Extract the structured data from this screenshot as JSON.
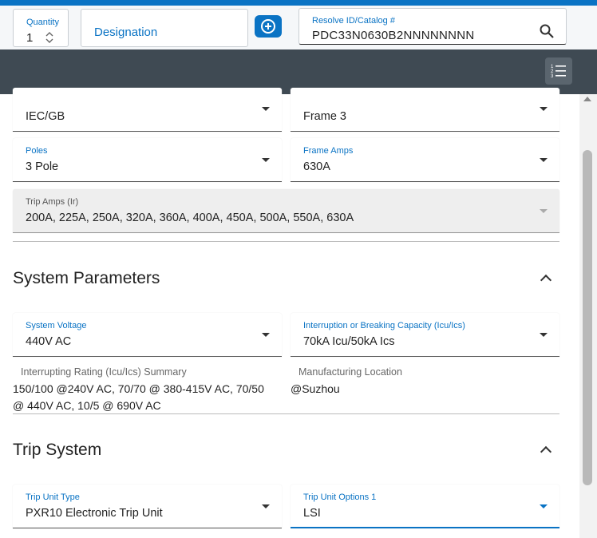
{
  "header": {
    "quantity_label": "Quantity",
    "quantity_value": "1",
    "designation_label": "Designation",
    "resolve_label": "Resolve ID/Catalog #",
    "resolve_value": "PDC33N0630B2NNNNNNNN"
  },
  "fields_top": {
    "standard_value": "IEC/GB",
    "frame_value": "Frame 3",
    "poles_label": "Poles",
    "poles_value": "3 Pole",
    "frame_amps_label": "Frame Amps",
    "frame_amps_value": "630A",
    "trip_amps_label": "Trip Amps (Ir)",
    "trip_amps_value": "200A, 225A, 250A, 320A, 360A, 400A, 450A, 500A, 550A, 630A"
  },
  "system_parameters": {
    "title": "System Parameters",
    "voltage_label": "System Voltage",
    "voltage_value": "440V AC",
    "capacity_label": "Interruption or Breaking Capacity (Icu/Ics)",
    "capacity_value": "70kA Icu/50kA Ics",
    "rating_summary_label": "Interrupting Rating (Icu/Ics) Summary",
    "rating_summary_value_1": "150/100 @240V AC, 70/70 @ 380-415V AC, 70/50",
    "rating_summary_value_2": "@ 440V AC, 10/5 @ 690V AC",
    "location_label": "Manufacturing Location",
    "location_value": "@Suzhou"
  },
  "trip_system": {
    "title": "Trip System",
    "unit_type_label": "Trip Unit Type",
    "unit_type_value": "PXR10 Electronic Trip Unit",
    "options_label": "Trip Unit Options 1",
    "options_value": "LSI"
  },
  "colors": {
    "accent": "#0a73c4",
    "dark_bar": "#3f4a53"
  },
  "icons": [
    "plus-circle-icon",
    "search-icon",
    "list-icon",
    "chevron-down-icon",
    "chevron-up-icon"
  ]
}
